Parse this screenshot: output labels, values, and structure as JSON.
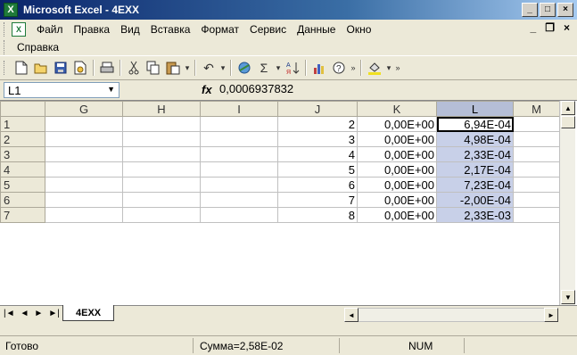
{
  "window": {
    "title": "Microsoft Excel - 4EXX",
    "app_icon_glyph": "X",
    "minimize": "_",
    "maximize": "□",
    "close": "×"
  },
  "menu": {
    "items": [
      "Файл",
      "Правка",
      "Вид",
      "Вставка",
      "Формат",
      "Сервис",
      "Данные",
      "Окно"
    ],
    "row2_items": [
      "Справка"
    ],
    "doc_minimize": "_",
    "doc_restore": "❐",
    "doc_close": "×"
  },
  "toolbar": {
    "icons": [
      "new-document-icon",
      "open-folder-icon",
      "save-icon",
      "permission-icon",
      "print-icon",
      "cut-icon",
      "copy-icon",
      "paste-icon",
      "undo-icon",
      "hyperlink-icon",
      "autosum-icon",
      "sort-ascending-icon",
      "chart-wizard-icon",
      "help-icon",
      "fill-color-icon"
    ],
    "autosum_label": "Σ",
    "more_label": "»"
  },
  "formula_bar": {
    "name_box": "L1",
    "fx_label": "fx",
    "formula": "0,0006937832"
  },
  "grid": {
    "columns": [
      "G",
      "H",
      "I",
      "J",
      "K",
      "L",
      "M"
    ],
    "selected_column": "L",
    "rows": [
      {
        "row": "1",
        "J": "2",
        "K": "0,00E+00",
        "L": "6,94E-04"
      },
      {
        "row": "2",
        "J": "3",
        "K": "0,00E+00",
        "L": "4,98E-04"
      },
      {
        "row": "3",
        "J": "4",
        "K": "0,00E+00",
        "L": "2,33E-04"
      },
      {
        "row": "4",
        "J": "5",
        "K": "0,00E+00",
        "L": "2,17E-04"
      },
      {
        "row": "5",
        "J": "6",
        "K": "0,00E+00",
        "L": "7,23E-04"
      },
      {
        "row": "6",
        "J": "7",
        "K": "0,00E+00",
        "L": "-2,00E-04"
      },
      {
        "row": "7",
        "J": "8",
        "K": "0,00E+00",
        "L": "2,33E-03"
      }
    ]
  },
  "sheets": {
    "tabs": [
      "4EXX"
    ],
    "active": "4EXX"
  },
  "status": {
    "ready": "Готово",
    "sum": "Сумма=2,58E-02",
    "num": "NUM"
  }
}
